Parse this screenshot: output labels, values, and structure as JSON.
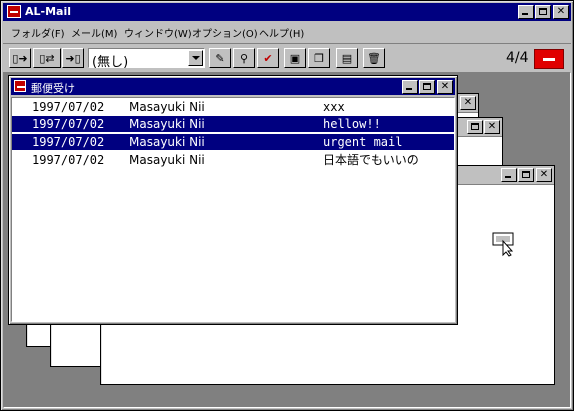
{
  "window": {
    "title": "AL-Mail"
  },
  "menu": [
    {
      "label": "フォルダ(F)"
    },
    {
      "label": "メール(M)"
    },
    {
      "label": "ウィンドウ(W)"
    },
    {
      "label": "オプション(O)"
    },
    {
      "label": "ヘルプ(H)"
    }
  ],
  "toolbar": {
    "folder_select": {
      "value": "(無し)"
    },
    "mail_count": "4/4",
    "icons": [
      "receive-icon",
      "send-receive-icon",
      "send-icon",
      "compose-icon",
      "find-icon",
      "check-icon",
      "save-icon",
      "copy-icon",
      "properties-icon",
      "trash-icon",
      "mailbox-icon"
    ]
  },
  "mailbox": {
    "title": "郵便受け",
    "messages": [
      {
        "date": "1997/07/02",
        "from": "Masayuki Nii",
        "subject": "xxx",
        "selected": false
      },
      {
        "date": "1997/07/02",
        "from": "Masayuki Nii",
        "subject": "hellow!!",
        "selected": true
      },
      {
        "date": "1997/07/02",
        "from": "Masayuki Nii",
        "subject": "urgent mail",
        "selected": true
      },
      {
        "date": "1997/07/02",
        "from": "Masayuki Nii",
        "subject": "日本語でもいいの",
        "selected": false
      }
    ]
  },
  "colors": {
    "titlebar": "#000080",
    "selection": "#000080",
    "face": "#c0c0c0",
    "mdi_background": "#808080"
  }
}
